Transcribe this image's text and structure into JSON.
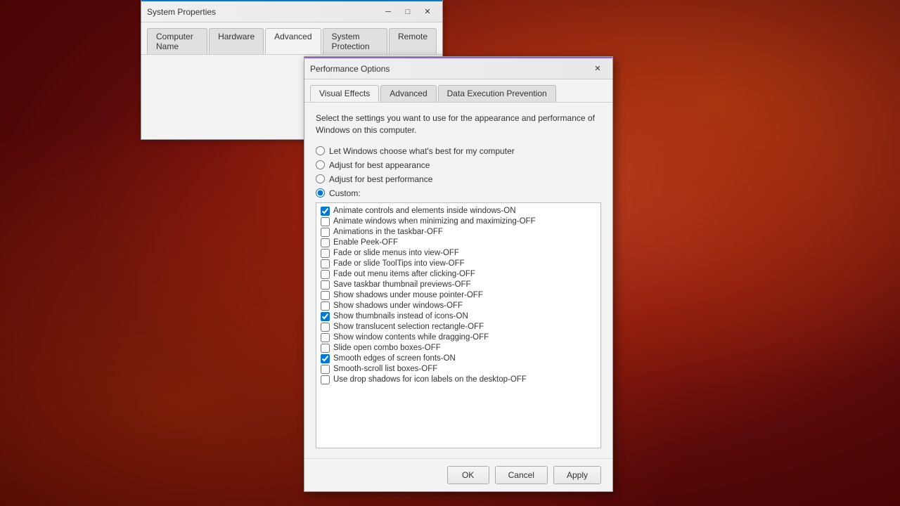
{
  "background": {
    "color": "#8b1a1a"
  },
  "system_properties": {
    "title": "System Properties",
    "tabs": [
      {
        "label": "Computer Name",
        "active": false
      },
      {
        "label": "Hardware",
        "active": false
      },
      {
        "label": "Advanced",
        "active": true
      },
      {
        "label": "System Protection",
        "active": false
      },
      {
        "label": "Remote",
        "active": false
      }
    ],
    "close_btn": "✕"
  },
  "performance_options": {
    "title": "Performance Options",
    "close_btn": "✕",
    "tabs": [
      {
        "label": "Visual Effects",
        "active": true
      },
      {
        "label": "Advanced",
        "active": false
      },
      {
        "label": "Data Execution Prevention",
        "active": false
      }
    ],
    "description": "Select the settings you want to use for the appearance and performance of Windows on this computer.",
    "radio_options": [
      {
        "id": "opt1",
        "label": "Let Windows choose what's best for my computer",
        "checked": false
      },
      {
        "id": "opt2",
        "label": "Adjust for best appearance",
        "checked": false
      },
      {
        "id": "opt3",
        "label": "Adjust for best performance",
        "checked": false
      },
      {
        "id": "opt4",
        "label": "Custom:",
        "checked": true
      }
    ],
    "checkboxes": [
      {
        "label": "Animate controls and elements inside windows",
        "checked": true,
        "status": "ON"
      },
      {
        "label": "Animate windows when minimizing and maximizing",
        "checked": false,
        "status": "OFF"
      },
      {
        "label": "Animations in the taskbar",
        "checked": false,
        "status": "OFF"
      },
      {
        "label": "Enable Peek",
        "checked": false,
        "status": "OFF"
      },
      {
        "label": "Fade or slide menus into view",
        "checked": false,
        "status": "OFF"
      },
      {
        "label": "Fade or slide ToolTips into view",
        "checked": false,
        "status": "OFF"
      },
      {
        "label": "Fade out menu items after clicking",
        "checked": false,
        "status": "OFF"
      },
      {
        "label": "Save taskbar thumbnail previews",
        "checked": false,
        "status": "OFF"
      },
      {
        "label": "Show shadows under mouse pointer",
        "checked": false,
        "status": "OFF"
      },
      {
        "label": "Show shadows under windows",
        "checked": false,
        "status": "OFF"
      },
      {
        "label": "Show thumbnails instead of icons",
        "checked": true,
        "status": "ON"
      },
      {
        "label": "Show translucent selection rectangle",
        "checked": false,
        "status": "OFF"
      },
      {
        "label": "Show window contents while dragging",
        "checked": false,
        "status": "OFF"
      },
      {
        "label": "Slide open combo boxes",
        "checked": false,
        "status": "OFF"
      },
      {
        "label": "Smooth edges of screen fonts",
        "checked": true,
        "status": "ON"
      },
      {
        "label": "Smooth-scroll list boxes",
        "checked": false,
        "status": "OFF"
      },
      {
        "label": "Use drop shadows for icon labels on the desktop",
        "checked": false,
        "status": "OFF"
      }
    ],
    "buttons": {
      "ok": "OK",
      "cancel": "Cancel",
      "apply": "Apply"
    }
  }
}
